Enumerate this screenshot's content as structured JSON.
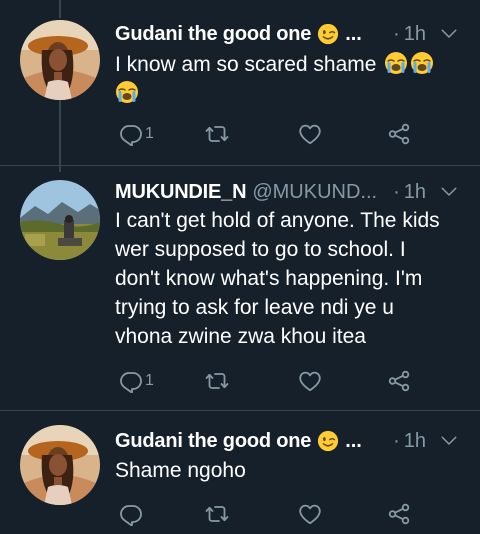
{
  "tweets": [
    {
      "name": "Gudani the good one",
      "name_emoji": "winking-face",
      "ellipsis": "...",
      "handle": "",
      "dot": "·",
      "time": "1h",
      "text": "I know am so scared shame",
      "text_emoji": [
        "loudly-crying-face",
        "loudly-crying-face",
        "loudly-crying-face"
      ],
      "reply_count": "1"
    },
    {
      "name": "MUKUNDIE_N",
      "handle": "@MUKUND...",
      "dot": "·",
      "time": "1h",
      "text_lines": [
        "I can't get hold of anyone. The kids",
        "wer supposed to go to school. I",
        "don't know what's happening. I'm",
        "trying to ask for leave ndi ye u",
        "vhona zwine zwa khou itea"
      ],
      "reply_count": "1"
    },
    {
      "name": "Gudani the good one",
      "name_emoji": "winking-face",
      "ellipsis": "...",
      "dot": "·",
      "time": "1h",
      "text": "Shame ngoho",
      "reply_count": ""
    }
  ],
  "colors": {
    "background": "#15202b",
    "secondary_text": "#8899a6",
    "divider": "#38444d",
    "primary_text": "#ffffff"
  },
  "icons": [
    "reply-icon",
    "retweet-icon",
    "like-icon",
    "share-icon",
    "chevron-down-icon"
  ]
}
